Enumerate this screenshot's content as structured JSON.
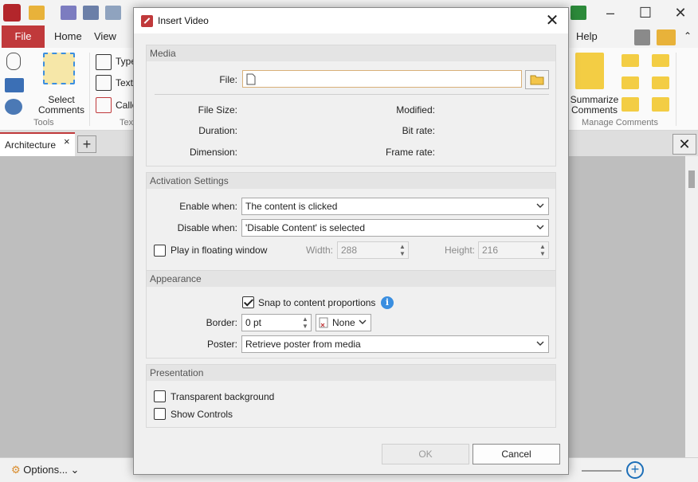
{
  "app": {
    "menu_tabs": [
      "File",
      "Home",
      "View",
      "Help"
    ],
    "ribbon": {
      "select_comments_label": "Select Comments",
      "typewriter_label": "Type",
      "textbox_label": "Text",
      "callout_label": "Callo",
      "summarize_label": "Summarize Comments",
      "group_tools": "Tools",
      "group_text": "Tex",
      "group_manage": "Manage Comments"
    },
    "doc_tab": "Architecture",
    "status": {
      "options_label": "Options..."
    }
  },
  "dialog": {
    "title": "Insert Video",
    "sections": {
      "media": "Media",
      "activation": "Activation Settings",
      "appearance": "Appearance",
      "presentation": "Presentation"
    },
    "media": {
      "file_label": "File:",
      "file_value": "",
      "file_size_label": "File Size:",
      "duration_label": "Duration:",
      "dimension_label": "Dimension:",
      "modified_label": "Modified:",
      "bitrate_label": "Bit rate:",
      "framerate_label": "Frame rate:"
    },
    "activation": {
      "enable_label": "Enable when:",
      "enable_value": "The content is clicked",
      "disable_label": "Disable when:",
      "disable_value": "'Disable Content' is selected",
      "floating_label": "Play in floating window",
      "floating_checked": false,
      "width_label": "Width:",
      "width_value": "288",
      "height_label": "Height:",
      "height_value": "216"
    },
    "appearance": {
      "snap_label": "Snap to content proportions",
      "snap_checked": true,
      "border_label": "Border:",
      "border_value": "0 pt",
      "border_style_value": "None",
      "poster_label": "Poster:",
      "poster_value": "Retrieve poster from media"
    },
    "presentation": {
      "transparent_label": "Transparent background",
      "transparent_checked": false,
      "controls_label": "Show Controls",
      "controls_checked": false
    },
    "buttons": {
      "ok": "OK",
      "cancel": "Cancel"
    }
  },
  "colors": {
    "accent": "#c0393b",
    "info": "#3a8ee0",
    "file_border": "#d9b078"
  }
}
